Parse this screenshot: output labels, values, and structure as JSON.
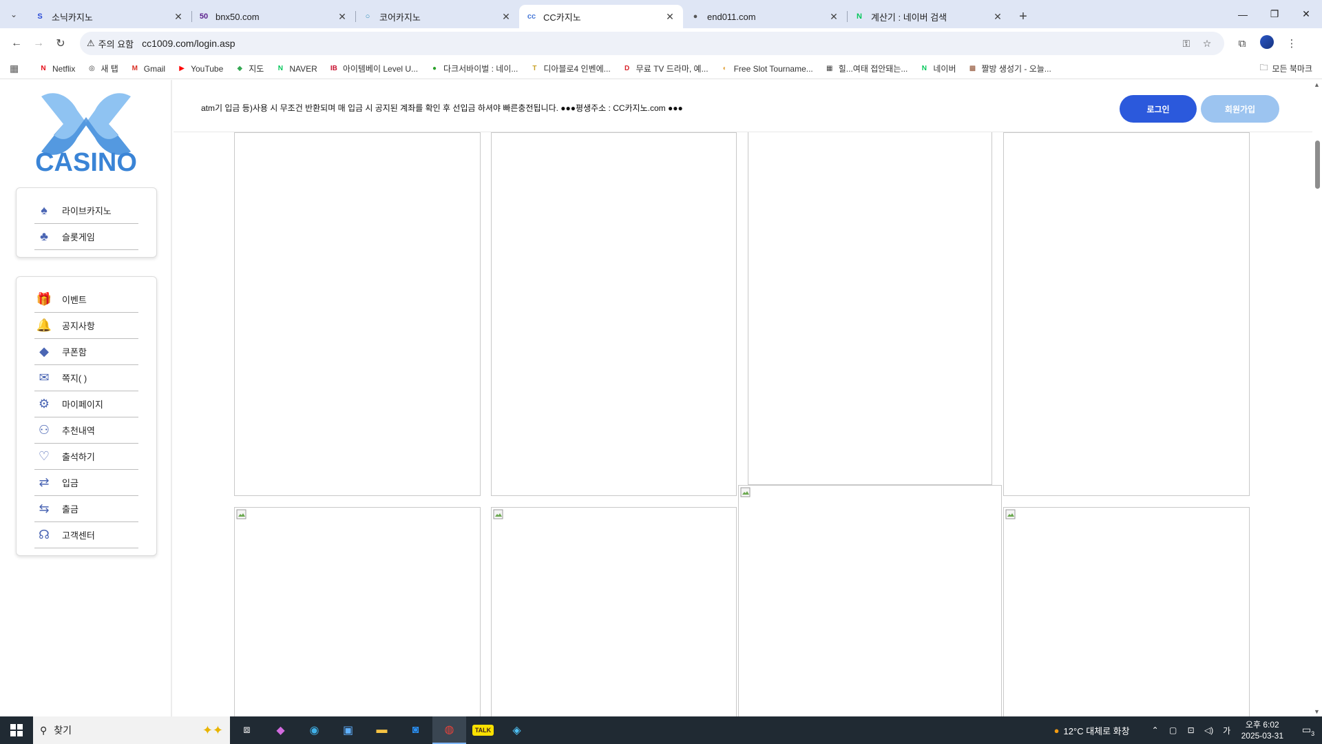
{
  "browser": {
    "tabs": [
      {
        "title": "소닉카지노",
        "fav_text": "S",
        "fav_color": "#2a4bd7"
      },
      {
        "title": "bnx50.com",
        "fav_text": "50",
        "fav_color": "#5a1e8c"
      },
      {
        "title": "코어카지노",
        "fav_text": "○",
        "fav_color": "#2a8ab5"
      },
      {
        "title": "CC카지노",
        "fav_text": "cc",
        "fav_color": "#4b7bd8"
      },
      {
        "title": "end011.com",
        "fav_text": "●",
        "fav_color": "#555555"
      },
      {
        "title": "계산기 : 네이버 검색",
        "fav_text": "N",
        "fav_color": "#03c75a"
      }
    ],
    "active_tab": 3,
    "address": {
      "warning": "주의 요함",
      "url": "cc1009.com/login.asp"
    },
    "bookmarks": [
      {
        "label": "Netflix",
        "icon": "N",
        "color": "#e50914"
      },
      {
        "label": "새 탭",
        "icon": "◎",
        "color": "#333333"
      },
      {
        "label": "Gmail",
        "icon": "M",
        "color": "#d93025"
      },
      {
        "label": "YouTube",
        "icon": "▶",
        "color": "#ff0000"
      },
      {
        "label": "지도",
        "icon": "◆",
        "color": "#34a853"
      },
      {
        "label": "NAVER",
        "icon": "N",
        "color": "#03c75a"
      },
      {
        "label": "아이템베이 Level U...",
        "icon": "IB",
        "color": "#c8102e"
      },
      {
        "label": "다크서바이벌 : 네이...",
        "icon": "●",
        "color": "#2aa12a"
      },
      {
        "label": "디아블로4 인벤에...",
        "icon": "T",
        "color": "#c9a227"
      },
      {
        "label": "무료 TV 드라마, 예...",
        "icon": "D",
        "color": "#d8232a"
      },
      {
        "label": "Free Slot Tourname...",
        "icon": "◐",
        "color": "#e1a23b"
      },
      {
        "label": "힐...여태 접안돼는...",
        "icon": "▦",
        "color": "#444444"
      },
      {
        "label": "네이버",
        "icon": "N",
        "color": "#03c75a"
      },
      {
        "label": "짤방 생성기 - 오늘...",
        "icon": "▩",
        "color": "#8b4a2b"
      }
    ],
    "all_bookmarks": "모든 북마크"
  },
  "site": {
    "logo_text": "CASINO",
    "logo_colors": {
      "light": "#8fc3f2",
      "dark": "#3a84d6"
    },
    "menu_primary": [
      {
        "label": "라이브카지노",
        "icon": "spade-icon"
      },
      {
        "label": "슬롯게임",
        "icon": "clover-icon"
      }
    ],
    "menu_secondary": [
      {
        "label": "이벤트",
        "icon": "gift-icon"
      },
      {
        "label": "공지사항",
        "icon": "bell-icon"
      },
      {
        "label": "쿠폰함",
        "icon": "ticket-icon"
      },
      {
        "label": "쪽지( )",
        "icon": "mail-icon"
      },
      {
        "label": "마이페이지",
        "icon": "user-gear-icon"
      },
      {
        "label": "추천내역",
        "icon": "users-plus-icon"
      },
      {
        "label": "출석하기",
        "icon": "calendar-heart-icon"
      },
      {
        "label": "입금",
        "icon": "deposit-icon"
      },
      {
        "label": "출금",
        "icon": "withdraw-icon"
      },
      {
        "label": "고객센터",
        "icon": "headset-icon"
      }
    ],
    "notice": "atm기 입금 등)사용 시 무조건 반환되며 매 입금 시 공지된 계좌를 확인 후 선입금 하셔야 빠른충전됩니다. ●●●평생주소 : CC카지노.com ●●●",
    "login_label": "로그인",
    "join_label": "회원가입",
    "accent_color": "#2b59dc",
    "join_color": "#9cc4f0"
  },
  "taskbar": {
    "search_placeholder": "찾기",
    "weather": "12°C 대체로 화창",
    "time": "오후 6:02",
    "date": "2025-03-31",
    "notifications": "3"
  }
}
